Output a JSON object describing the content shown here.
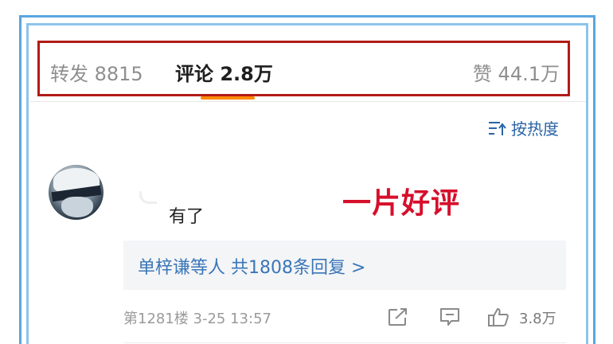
{
  "tabs": {
    "repost": "转发 8815",
    "comments": "评论 2.8万",
    "likes": "赞 44.1万"
  },
  "sort": {
    "label": "按热度",
    "icon": "sort-icon"
  },
  "comment": {
    "text": "有了",
    "overlay_text": "一片好评",
    "replies_summary": "单梓谦等人  共1808条回复 >",
    "meta": "第1281楼 3-25 13:57",
    "like_count": "3.8万"
  },
  "colors": {
    "highlight_border": "#b11b16",
    "frame_border": "#5aa6df",
    "tab_underline": "#ff8a00",
    "link_blue": "#3a76b8",
    "overlay_red": "#d60f2b"
  },
  "icons": [
    "share-icon",
    "comment-icon",
    "like-icon",
    "avatar"
  ]
}
